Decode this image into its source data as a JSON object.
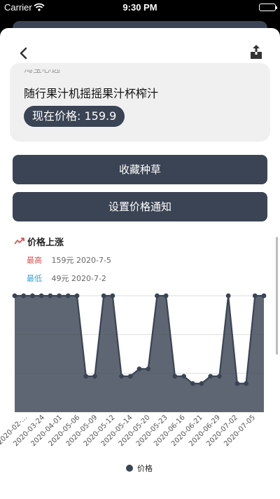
{
  "status_bar": {
    "carrier": "Carrier",
    "time": "9:30 PM"
  },
  "product": {
    "source": "淘宝心选",
    "name": "随行果汁机摇摇果汁杯榨汁",
    "price_text": "现在价格: 159.9"
  },
  "buttons": {
    "collect": "收藏种草",
    "notify": "设置价格通知"
  },
  "chart_section": {
    "title": "价格上涨",
    "high_label": "最高",
    "high_value": "159元 2020-7-5",
    "low_label": "最低",
    "low_value": "49元 2020-7-2"
  },
  "colors": {
    "primary": "#3b4454",
    "high": "#e24f4f",
    "low": "#2ea7d8",
    "trend_icon": "#e24f4f",
    "card_bg": "#f0f0f0"
  },
  "icons": {
    "back": "chevron-left-icon",
    "share": "share-icon",
    "trend": "trend-up-icon"
  },
  "chart_data": {
    "type": "area",
    "x": [
      "2020-02-...",
      "2020-03-24",
      "2020-04-01",
      "2020-05-06",
      "2020-05-09",
      "2020-05-12",
      "2020-05-14",
      "2020-05-20",
      "2020-05-23",
      "2020-06-16",
      "2020-06-21",
      "2020-06-29",
      "2020-07-02",
      "2020-07-05"
    ],
    "series": [
      {
        "name": "价格",
        "values": [
          159,
          159,
          159,
          159,
          159,
          159,
          159,
          159,
          49,
          49,
          159,
          159,
          49,
          49,
          59,
          59,
          159,
          159,
          49,
          49,
          39,
          39,
          49,
          49,
          159,
          39,
          39,
          159,
          159
        ]
      }
    ],
    "ylim": [
      0,
      159
    ],
    "grid": true,
    "legend": "bottom-center"
  }
}
